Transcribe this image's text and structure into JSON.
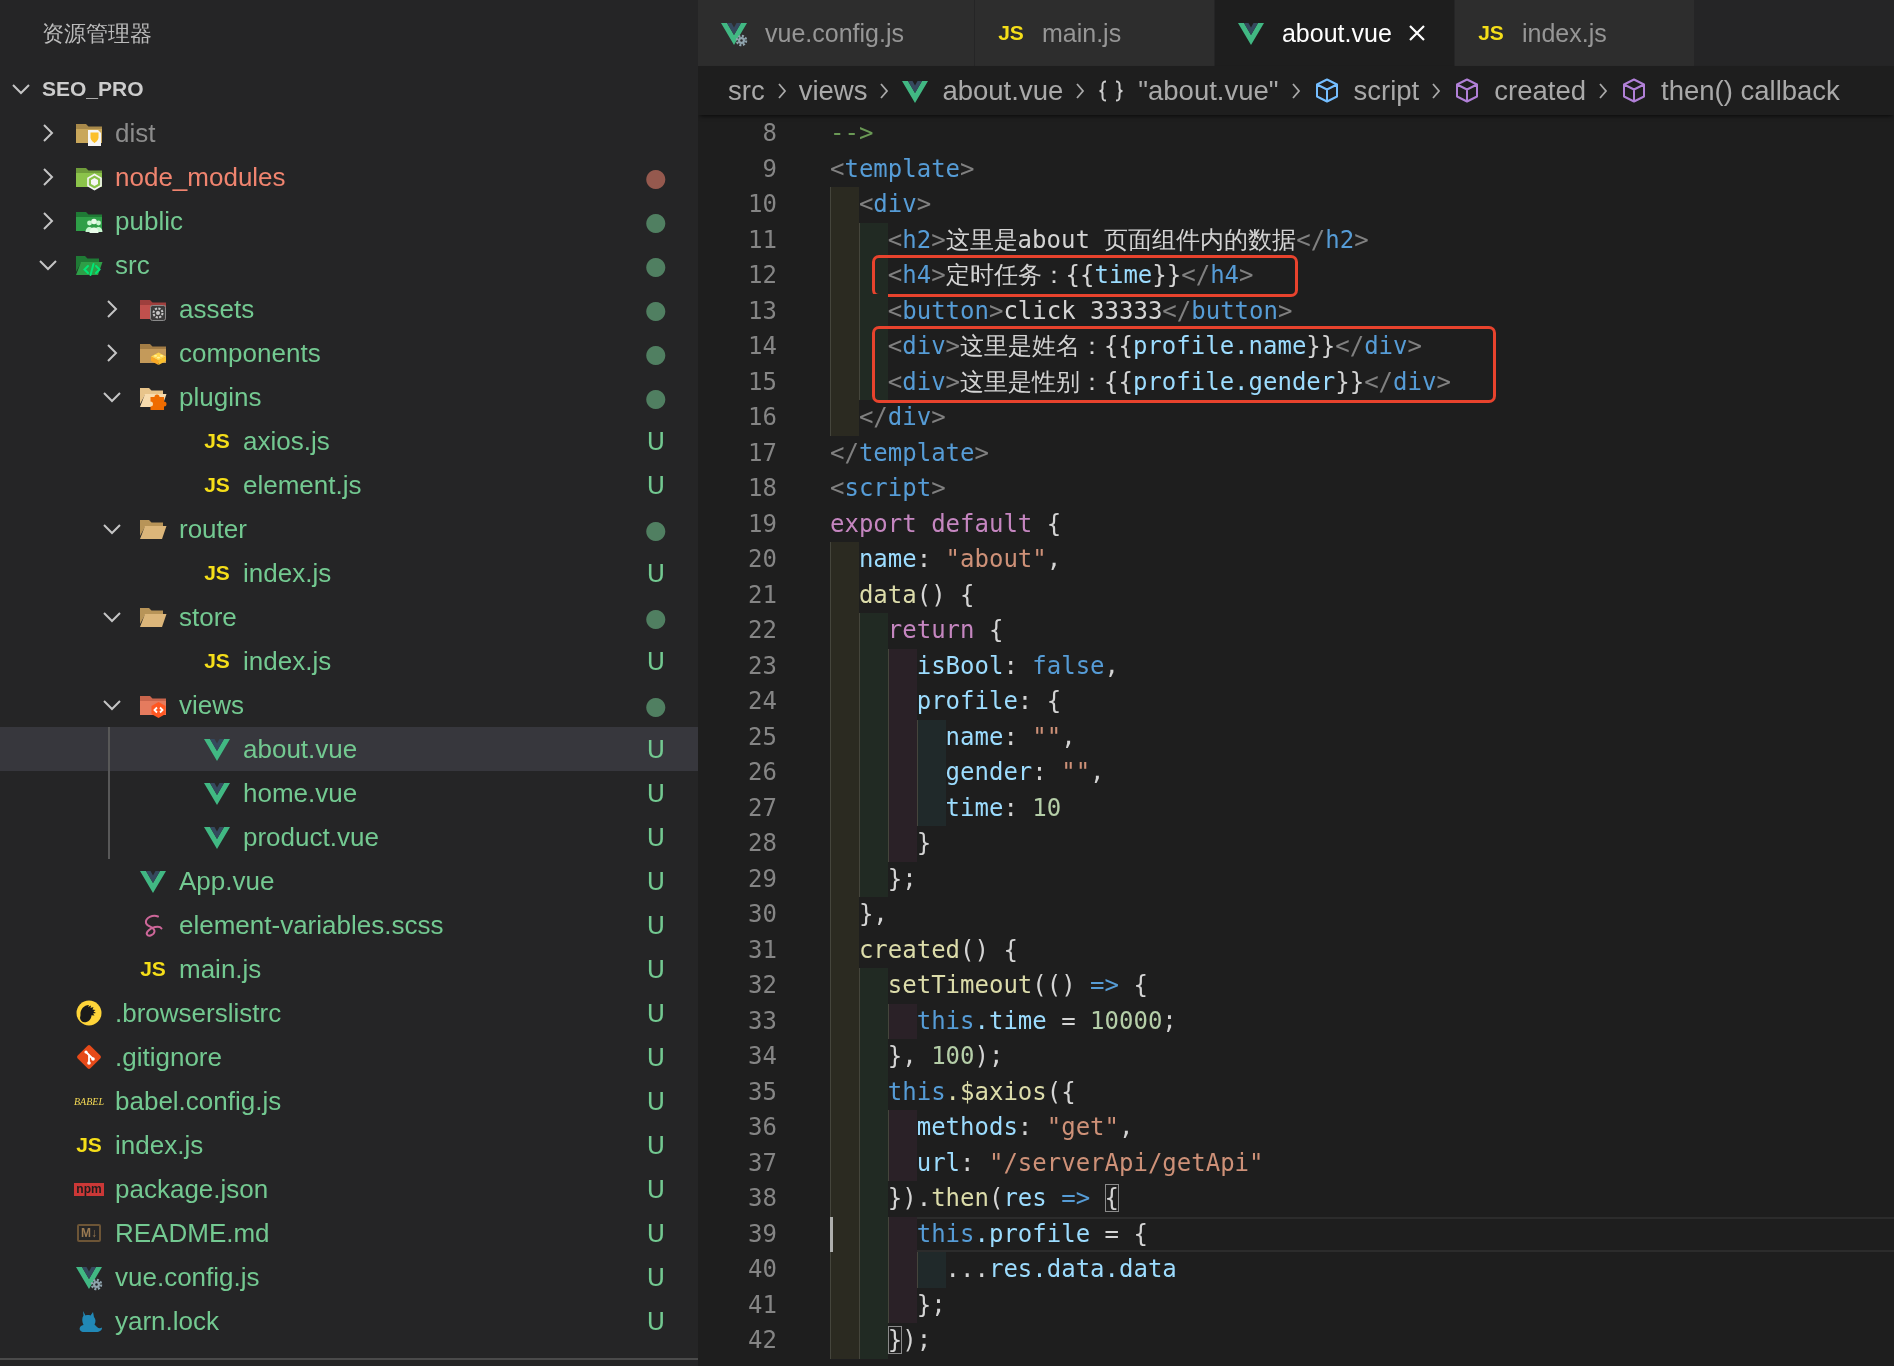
{
  "explorer": {
    "title": "资源管理器",
    "project": {
      "name": "SEO_PRO",
      "expanded": true,
      "items": [
        {
          "name": "dist",
          "kind": "distfolder",
          "expanded": false,
          "color": "#8c8c8c",
          "selected": false
        },
        {
          "name": "node_modules",
          "kind": "nodefolder",
          "expanded": false,
          "color": "#f0846f",
          "badge": "●",
          "selected": false
        },
        {
          "name": "public",
          "kind": "publicfolder",
          "expanded": false,
          "color": "#73c991",
          "badge": "●",
          "selected": false
        },
        {
          "name": "src",
          "kind": "srcfolder",
          "expanded": true,
          "color": "#73c991",
          "badge": "●",
          "selected": false,
          "children": [
            {
              "name": "assets",
              "kind": "assetsfolder",
              "expanded": false,
              "color": "#73c991",
              "badge": "●",
              "selected": false
            },
            {
              "name": "components",
              "kind": "componentsfolder",
              "expanded": false,
              "color": "#73c991",
              "badge": "●",
              "selected": false
            },
            {
              "name": "plugins",
              "kind": "pluginsfolder",
              "expanded": true,
              "color": "#73c991",
              "badge": "●",
              "selected": false,
              "children": [
                {
                  "name": "axios.js",
                  "kind": "js",
                  "icon_text": "JS",
                  "color": "#73c991",
                  "badge": "U",
                  "selected": false
                },
                {
                  "name": "element.js",
                  "kind": "js",
                  "icon_text": "JS",
                  "color": "#73c991",
                  "badge": "U",
                  "selected": false
                }
              ]
            },
            {
              "name": "router",
              "kind": "folder",
              "expanded": true,
              "color": "#73c991",
              "badge": "●",
              "selected": false,
              "children": [
                {
                  "name": "index.js",
                  "kind": "js",
                  "icon_text": "JS",
                  "color": "#73c991",
                  "badge": "U",
                  "selected": false
                }
              ]
            },
            {
              "name": "store",
              "kind": "folder",
              "expanded": true,
              "color": "#73c991",
              "badge": "●",
              "selected": false,
              "children": [
                {
                  "name": "index.js",
                  "kind": "js",
                  "icon_text": "JS",
                  "color": "#73c991",
                  "badge": "U",
                  "selected": false
                }
              ]
            },
            {
              "name": "views",
              "kind": "viewsfolder",
              "expanded": true,
              "color": "#73c991",
              "badge": "●",
              "selected": false,
              "children": [
                {
                  "name": "about.vue",
                  "kind": "vue",
                  "color": "#73c991",
                  "badge": "U",
                  "selected": true
                },
                {
                  "name": "home.vue",
                  "kind": "vue",
                  "color": "#73c991",
                  "badge": "U",
                  "selected": false
                },
                {
                  "name": "product.vue",
                  "kind": "vue",
                  "color": "#73c991",
                  "badge": "U",
                  "selected": false
                }
              ]
            },
            {
              "name": "App.vue",
              "kind": "vue",
              "color": "#73c991",
              "badge": "U",
              "selected": false
            },
            {
              "name": "element-variables.scss",
              "kind": "scss",
              "color": "#73c991",
              "badge": "U",
              "selected": false
            },
            {
              "name": "main.js",
              "kind": "js",
              "icon_text": "JS",
              "color": "#73c991",
              "badge": "U",
              "selected": false
            }
          ]
        },
        {
          "name": ".browserslistrc",
          "kind": "browserslist",
          "color": "#73c991",
          "badge": "U",
          "selected": false
        },
        {
          "name": ".gitignore",
          "kind": "gitignore",
          "color": "#73c991",
          "badge": "U",
          "selected": false
        },
        {
          "name": "babel.config.js",
          "kind": "babel",
          "icon_text": "BABEL",
          "color": "#73c991",
          "badge": "U",
          "selected": false
        },
        {
          "name": "index.js",
          "kind": "js",
          "icon_text": "JS",
          "color": "#73c991",
          "badge": "U",
          "selected": false
        },
        {
          "name": "package.json",
          "kind": "npm",
          "icon_text": "npm",
          "color": "#73c991",
          "badge": "U",
          "selected": false
        },
        {
          "name": "README.md",
          "kind": "markdown",
          "icon_text": "M↓",
          "color": "#73c991",
          "badge": "U",
          "selected": false
        },
        {
          "name": "vue.config.js",
          "kind": "vueconfig",
          "color": "#73c991",
          "badge": "U",
          "selected": false
        },
        {
          "name": "yarn.lock",
          "kind": "yarn",
          "color": "#73c991",
          "badge": "U",
          "selected": false
        }
      ]
    }
  },
  "tabs": [
    {
      "label": "vue.config.js",
      "kind": "vueconfig",
      "selected": false
    },
    {
      "label": "main.js",
      "kind": "js",
      "icon_text": "JS",
      "selected": false
    },
    {
      "label": "about.vue",
      "kind": "vue",
      "selected": true
    },
    {
      "label": "index.js",
      "kind": "js",
      "icon_text": "JS",
      "selected": false
    }
  ],
  "breadcrumb": [
    {
      "label": "src",
      "kind": "folder"
    },
    {
      "label": "views",
      "kind": "folder"
    },
    {
      "label": "about.vue",
      "kind": "vue"
    },
    {
      "label": "\"about.vue\"",
      "kind": "object"
    },
    {
      "label": "script",
      "kind": "module"
    },
    {
      "label": "created",
      "kind": "method"
    },
    {
      "label": "then() callback",
      "kind": "method"
    }
  ],
  "editor": {
    "lines": [
      {
        "number": "8",
        "current": false,
        "marked": false,
        "tokens": [
          {
            "kind": "comment",
            "text": "-->"
          }
        ]
      },
      {
        "number": "9",
        "current": false,
        "marked": false,
        "tokens": [
          {
            "kind": "punct",
            "text": "<"
          },
          {
            "kind": "tag",
            "text": "template"
          },
          {
            "kind": "punct",
            "text": ">"
          }
        ]
      },
      {
        "number": "10",
        "current": false,
        "marked": false,
        "tokens": [
          {
            "kind": "punct",
            "text": "  <"
          },
          {
            "kind": "tag",
            "text": "div"
          },
          {
            "kind": "punct",
            "text": ">"
          }
        ]
      },
      {
        "number": "11",
        "current": false,
        "marked": false,
        "tokens": [
          {
            "kind": "punct",
            "text": "    <"
          },
          {
            "kind": "tag",
            "text": "h2"
          },
          {
            "kind": "punct",
            "text": ">"
          },
          {
            "kind": "text",
            "text": "这里是about 页面组件内的数据"
          },
          {
            "kind": "punct",
            "text": "</"
          },
          {
            "kind": "tag",
            "text": "h2"
          },
          {
            "kind": "punct",
            "text": ">"
          }
        ]
      },
      {
        "number": "12",
        "current": false,
        "marked": true,
        "tokens": [
          {
            "kind": "punct",
            "text": "    <"
          },
          {
            "kind": "tag",
            "text": "h4"
          },
          {
            "kind": "punct",
            "text": ">"
          },
          {
            "kind": "text",
            "text": "定时任务：{{"
          },
          {
            "kind": "var",
            "text": "time"
          },
          {
            "kind": "text",
            "text": "}}"
          },
          {
            "kind": "punct",
            "text": "</"
          },
          {
            "kind": "tag",
            "text": "h4"
          },
          {
            "kind": "punct",
            "text": ">"
          }
        ]
      },
      {
        "number": "13",
        "current": false,
        "marked": false,
        "tokens": [
          {
            "kind": "punct",
            "text": "    <"
          },
          {
            "kind": "tag",
            "text": "button"
          },
          {
            "kind": "punct",
            "text": ">"
          },
          {
            "kind": "text",
            "text": "click 33333"
          },
          {
            "kind": "punct",
            "text": "</"
          },
          {
            "kind": "tag",
            "text": "button"
          },
          {
            "kind": "punct",
            "text": ">"
          }
        ]
      },
      {
        "number": "14",
        "current": false,
        "marked": true,
        "tokens": [
          {
            "kind": "punct",
            "text": "    <"
          },
          {
            "kind": "tag",
            "text": "div"
          },
          {
            "kind": "punct",
            "text": ">"
          },
          {
            "kind": "text",
            "text": "这里是姓名：{{"
          },
          {
            "kind": "var",
            "text": "profile.name"
          },
          {
            "kind": "text",
            "text": "}}"
          },
          {
            "kind": "punct",
            "text": "</"
          },
          {
            "kind": "tag",
            "text": "div"
          },
          {
            "kind": "punct",
            "text": ">"
          }
        ]
      },
      {
        "number": "15",
        "current": false,
        "marked": true,
        "tokens": [
          {
            "kind": "punct",
            "text": "    <"
          },
          {
            "kind": "tag",
            "text": "div"
          },
          {
            "kind": "punct",
            "text": ">"
          },
          {
            "kind": "text",
            "text": "这里是性别：{{"
          },
          {
            "kind": "var",
            "text": "profile.gender"
          },
          {
            "kind": "text",
            "text": "}}"
          },
          {
            "kind": "punct",
            "text": "</"
          },
          {
            "kind": "tag",
            "text": "div"
          },
          {
            "kind": "punct",
            "text": ">"
          }
        ]
      },
      {
        "number": "16",
        "current": false,
        "marked": false,
        "tokens": [
          {
            "kind": "punct",
            "text": "  </"
          },
          {
            "kind": "tag",
            "text": "div"
          },
          {
            "kind": "punct",
            "text": ">"
          }
        ]
      },
      {
        "number": "17",
        "current": false,
        "marked": false,
        "tokens": [
          {
            "kind": "punct",
            "text": "</"
          },
          {
            "kind": "tag",
            "text": "template"
          },
          {
            "kind": "punct",
            "text": ">"
          }
        ]
      },
      {
        "number": "18",
        "current": false,
        "marked": false,
        "tokens": [
          {
            "kind": "punct",
            "text": "<"
          },
          {
            "kind": "tag",
            "text": "script"
          },
          {
            "kind": "punct",
            "text": ">"
          }
        ]
      },
      {
        "number": "19",
        "current": false,
        "marked": false,
        "tokens": [
          {
            "kind": "keyword",
            "text": "export default"
          },
          {
            "kind": "text",
            "text": " {"
          }
        ]
      },
      {
        "number": "20",
        "current": false,
        "marked": false,
        "tokens": [
          {
            "kind": "var",
            "text": "  name"
          },
          {
            "kind": "text",
            "text": ": "
          },
          {
            "kind": "string",
            "text": "\"about\""
          },
          {
            "kind": "text",
            "text": ","
          }
        ]
      },
      {
        "number": "21",
        "current": false,
        "marked": false,
        "tokens": [
          {
            "kind": "func",
            "text": "  data"
          },
          {
            "kind": "text",
            "text": "() {"
          }
        ]
      },
      {
        "number": "22",
        "current": false,
        "marked": false,
        "tokens": [
          {
            "kind": "keyword",
            "text": "    return"
          },
          {
            "kind": "text",
            "text": " {"
          }
        ]
      },
      {
        "number": "23",
        "current": false,
        "marked": false,
        "tokens": [
          {
            "kind": "var",
            "text": "      isBool"
          },
          {
            "kind": "text",
            "text": ": "
          },
          {
            "kind": "builtin",
            "text": "false"
          },
          {
            "kind": "text",
            "text": ","
          }
        ]
      },
      {
        "number": "24",
        "current": false,
        "marked": false,
        "tokens": [
          {
            "kind": "var",
            "text": "      profile"
          },
          {
            "kind": "text",
            "text": ": {"
          }
        ]
      },
      {
        "number": "25",
        "current": false,
        "marked": false,
        "tokens": [
          {
            "kind": "var",
            "text": "        name"
          },
          {
            "kind": "text",
            "text": ": "
          },
          {
            "kind": "string",
            "text": "\"\""
          },
          {
            "kind": "text",
            "text": ","
          }
        ]
      },
      {
        "number": "26",
        "current": false,
        "marked": false,
        "tokens": [
          {
            "kind": "var",
            "text": "        gender"
          },
          {
            "kind": "text",
            "text": ": "
          },
          {
            "kind": "string",
            "text": "\"\""
          },
          {
            "kind": "text",
            "text": ","
          }
        ]
      },
      {
        "number": "27",
        "current": false,
        "marked": false,
        "tokens": [
          {
            "kind": "var",
            "text": "        time"
          },
          {
            "kind": "text",
            "text": ": "
          },
          {
            "kind": "number",
            "text": "10"
          }
        ]
      },
      {
        "number": "28",
        "current": false,
        "marked": false,
        "tokens": [
          {
            "kind": "text",
            "text": "      }"
          }
        ]
      },
      {
        "number": "29",
        "current": false,
        "marked": false,
        "tokens": [
          {
            "kind": "text",
            "text": "    };"
          }
        ]
      },
      {
        "number": "30",
        "current": false,
        "marked": false,
        "tokens": [
          {
            "kind": "text",
            "text": "  },"
          }
        ]
      },
      {
        "number": "31",
        "current": false,
        "marked": false,
        "tokens": [
          {
            "kind": "func",
            "text": "  created"
          },
          {
            "kind": "text",
            "text": "() {"
          }
        ]
      },
      {
        "number": "32",
        "current": false,
        "marked": false,
        "tokens": [
          {
            "kind": "func",
            "text": "    setTimeout"
          },
          {
            "kind": "text",
            "text": "(() "
          },
          {
            "kind": "builtin",
            "text": "=>"
          },
          {
            "kind": "text",
            "text": " {"
          }
        ]
      },
      {
        "number": "33",
        "current": false,
        "marked": false,
        "tokens": [
          {
            "kind": "builtin",
            "text": "      this"
          },
          {
            "kind": "var",
            "text": ".time"
          },
          {
            "kind": "text",
            "text": " = "
          },
          {
            "kind": "number",
            "text": "10000"
          },
          {
            "kind": "text",
            "text": ";"
          }
        ]
      },
      {
        "number": "34",
        "current": false,
        "marked": false,
        "tokens": [
          {
            "kind": "text",
            "text": "    }, "
          },
          {
            "kind": "number",
            "text": "100"
          },
          {
            "kind": "text",
            "text": ");"
          }
        ]
      },
      {
        "number": "35",
        "current": false,
        "marked": false,
        "tokens": [
          {
            "kind": "builtin",
            "text": "    this"
          },
          {
            "kind": "func",
            "text": ".$axios"
          },
          {
            "kind": "text",
            "text": "({"
          }
        ]
      },
      {
        "number": "36",
        "current": false,
        "marked": false,
        "tokens": [
          {
            "kind": "var",
            "text": "      methods"
          },
          {
            "kind": "text",
            "text": ": "
          },
          {
            "kind": "string",
            "text": "\"get\""
          },
          {
            "kind": "text",
            "text": ","
          }
        ]
      },
      {
        "number": "37",
        "current": false,
        "marked": false,
        "tokens": [
          {
            "kind": "var",
            "text": "      url"
          },
          {
            "kind": "text",
            "text": ": "
          },
          {
            "kind": "string",
            "text": "\"/serverApi/getApi\""
          }
        ]
      },
      {
        "number": "38",
        "current": false,
        "marked": false,
        "tokens": [
          {
            "kind": "text",
            "text": "    })."
          },
          {
            "kind": "func",
            "text": "then"
          },
          {
            "kind": "text",
            "text": "("
          },
          {
            "kind": "var",
            "text": "res"
          },
          {
            "kind": "builtin",
            "text": " => "
          },
          {
            "kind": "bracket",
            "text": "{"
          }
        ]
      },
      {
        "number": "39",
        "current": true,
        "marked": false,
        "tokens": [
          {
            "kind": "builtin",
            "text": "      this"
          },
          {
            "kind": "var",
            "text": ".profile"
          },
          {
            "kind": "text",
            "text": " = {"
          }
        ]
      },
      {
        "number": "40",
        "current": false,
        "marked": false,
        "tokens": [
          {
            "kind": "text",
            "text": "        ..."
          },
          {
            "kind": "var",
            "text": "res.data.data"
          }
        ]
      },
      {
        "number": "41",
        "current": false,
        "marked": false,
        "tokens": [
          {
            "kind": "text",
            "text": "      };"
          }
        ]
      },
      {
        "number": "42",
        "current": false,
        "marked": false,
        "tokens": [
          {
            "kind": "bracket",
            "text": "    }"
          },
          {
            "kind": "text",
            "text": ");"
          }
        ]
      }
    ]
  }
}
